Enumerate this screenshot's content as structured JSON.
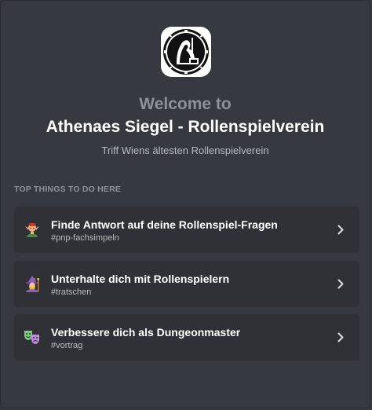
{
  "welcome": {
    "heading": "Welcome to",
    "server_name": "Athenaes Siegel - Rollenspielverein",
    "tagline": "Triff Wiens ältesten Rollenspielverein",
    "server_icon": "athenaes-siegel-logo"
  },
  "section": {
    "title": "TOP THINGS TO DO HERE"
  },
  "todos": [
    {
      "icon": "elf-emoji",
      "title": "Finde Antwort auf deine Rollenspiel-Fragen",
      "channel": "#pnp-fachsimpeln"
    },
    {
      "icon": "mage-emoji",
      "title": "Unterhalte dich mit Rollenspielern",
      "channel": "#tratschen"
    },
    {
      "icon": "performing-arts-emoji",
      "title": "Verbessere dich als Dungeonmaster",
      "channel": "#vortrag"
    }
  ],
  "colors": {
    "background": "#36393f",
    "card": "#2f3136",
    "title": "#ffffff",
    "muted": "#8e9297",
    "subtext": "#b9bbbe"
  }
}
